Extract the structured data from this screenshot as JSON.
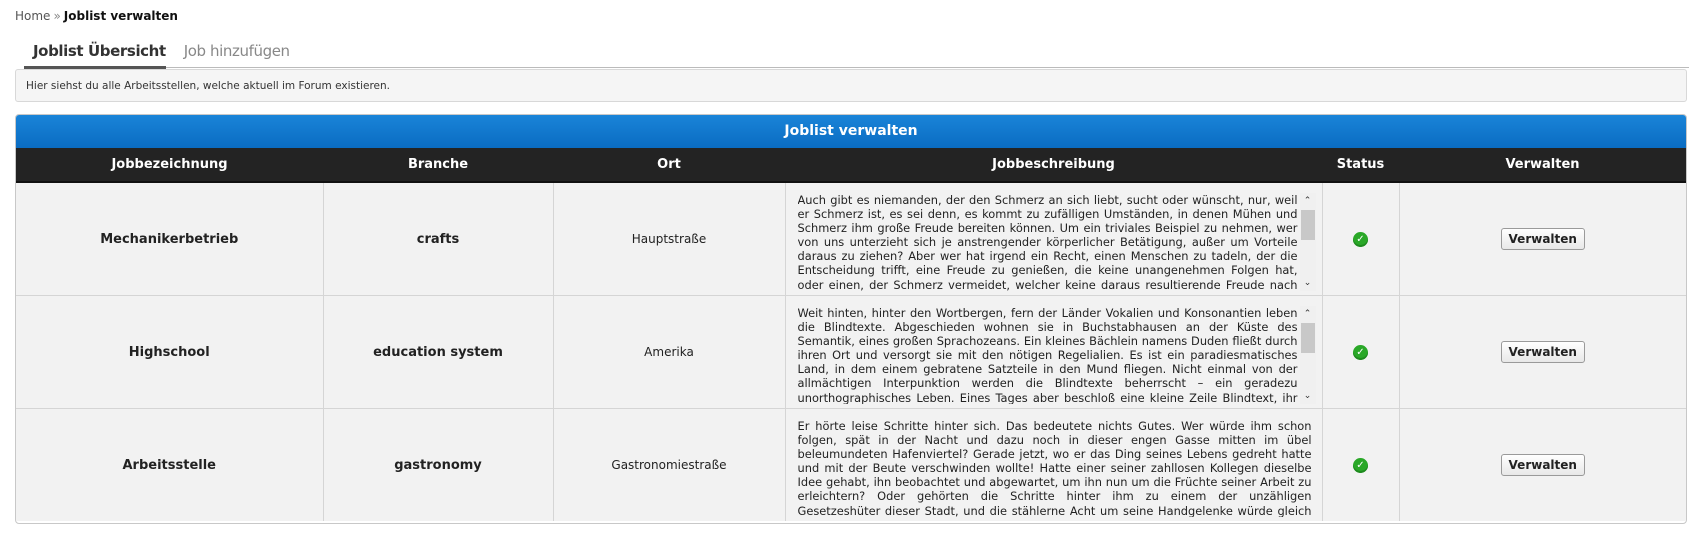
{
  "breadcrumb": {
    "home": "Home",
    "separator": "»",
    "current": "Joblist verwalten"
  },
  "tabs": [
    {
      "label": "Joblist Übersicht",
      "active": true
    },
    {
      "label": "Job hinzufügen",
      "active": false
    }
  ],
  "info_text": "Hier siehst du alle Arbeitsstellen, welche aktuell im Forum existieren.",
  "panel": {
    "title": "Joblist verwalten",
    "accent_color": "#0a6cc2",
    "columns": [
      "Jobbezeichnung",
      "Branche",
      "Ort",
      "Jobbeschreibung",
      "Status",
      "Verwalten"
    ],
    "rows": [
      {
        "name": "Mechanikerbetrieb",
        "branche": "crafts",
        "ort": "Hauptstraße",
        "beschreibung": "Auch gibt es niemanden, der den Schmerz an sich liebt, sucht oder wünscht, nur, weil er Schmerz ist, es sei denn, es kommt zu zufälligen Umständen, in denen Mühen und Schmerz ihm große Freude bereiten können. Um ein triviales Beispiel zu nehmen, wer von uns unterzieht sich je anstrengender körperlicher Betätigung, außer um Vorteile daraus zu ziehen? Aber wer hat irgend ein Recht, einen Menschen zu tadeln, der die Entscheidung trifft, eine Freude zu genießen, die keine unangenehmen Folgen hat, oder einen, der Schmerz vermeidet, welcher keine daraus resultierende Freude nach sich zieht? Auch gibt es niemanden, der den Schmerz an sich liebt,",
        "status_icon": "check-circle-icon",
        "button": "Verwalten",
        "scrollable": true
      },
      {
        "name": "Highschool",
        "branche": "education system",
        "ort": "Amerika",
        "beschreibung": "Weit hinten, hinter den Wortbergen, fern der Länder Vokalien und Konsonantien leben die Blindtexte. Abgeschieden wohnen sie in Buchstabhausen an der Küste des Semantik, eines großen Sprachozeans. Ein kleines Bächlein namens Duden fließt durch ihren Ort und versorgt sie mit den nötigen Regelialien. Es ist ein paradiesmatisches Land, in dem einem gebratene Satzteile in den Mund fliegen. Nicht einmal von der allmächtigen Interpunktion werden die Blindtexte beherrscht – ein geradezu unorthographisches Leben. Eines Tages aber beschloß eine kleine Zeile Blindtext, ihr Name war Lorem Ipsum, hinaus zu gehen in die weite Grammatik. Der große Oxmox riet ihr davon",
        "status_icon": "check-circle-icon",
        "button": "Verwalten",
        "scrollable": true
      },
      {
        "name": "Arbeitsstelle",
        "branche": "gastronomy",
        "ort": "Gastronomiestraße",
        "beschreibung": "Er hörte leise Schritte hinter sich. Das bedeutete nichts Gutes. Wer würde ihm schon folgen, spät in der Nacht und dazu noch in dieser engen Gasse mitten im übel beleumundeten Hafenviertel? Gerade jetzt, wo er das Ding seines Lebens gedreht hatte und mit der Beute verschwinden wollte! Hatte einer seiner zahllosen Kollegen dieselbe Idee gehabt, ihn beobachtet und abgewartet, um ihn nun um die Früchte seiner Arbeit zu erleichtern? Oder gehörten die Schritte hinter ihm zu einem der unzähligen Gesetzeshüter dieser Stadt, und die stählerne Acht um seine Handgelenke würde gleich zuschnappen? Er konnte die Aufforderung stehen zu bleiben schon",
        "status_icon": "check-circle-icon",
        "button": "Verwalten",
        "scrollable": false
      }
    ]
  }
}
